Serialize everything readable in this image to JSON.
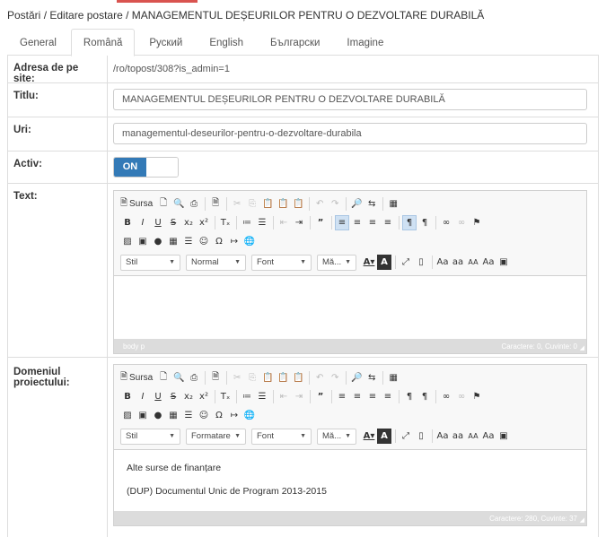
{
  "breadcrumb": {
    "root": "Postări",
    "sep1": " / ",
    "edit": "Editare postare",
    "sep2": " / ",
    "current": "MANAGEMENTUL DEȘEURILOR PENTRU O DEZVOLTARE DURABILĂ"
  },
  "tabs": [
    {
      "label": "General"
    },
    {
      "label": "Română"
    },
    {
      "label": "Руский"
    },
    {
      "label": "English"
    },
    {
      "label": "Български"
    },
    {
      "label": "Imagine"
    }
  ],
  "form": {
    "site_address_label": "Adresa de pe site:",
    "site_address_value": "/ro/topost/308?is_admin=1",
    "title_label": "Titlu:",
    "title_value": "MANAGEMENTUL DEȘEURILOR PENTRU O DEZVOLTARE DURABILĂ",
    "uri_label": "Uri:",
    "uri_value": "managementul-deseurilor-pentru-o-dezvoltare-durabila",
    "active_label": "Activ:",
    "active_state": "ON",
    "text_label": "Text:",
    "domain_label": "Domeniul proiectului:"
  },
  "editor1": {
    "source_label": "Sursa",
    "style_combo": "Stil",
    "format_combo": "Normal",
    "font_combo": "Font",
    "size_combo": "Mă...",
    "status_left": "body   p",
    "status_right": "Caractere: 0, Cuvinte: 0"
  },
  "editor2": {
    "source_label": "Sursa",
    "style_combo": "Stil",
    "format_combo": "Formatare",
    "font_combo": "Font",
    "size_combo": "Mă...",
    "lines": [
      "Alte surse de finanțare",
      "(DUP) Documentul Unic de Program 2013-2015"
    ],
    "status_right": "Caractere: 280, Cuvinte: 37"
  },
  "colors": {
    "accent": "#337ab7",
    "top_bar": "#d9534f",
    "statusbar": "#dcdcdc"
  }
}
